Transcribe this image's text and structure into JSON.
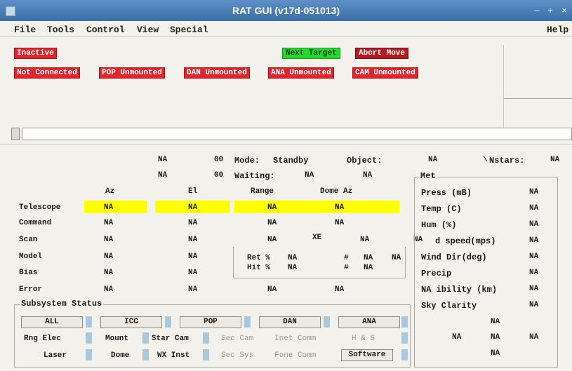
{
  "window": {
    "title": "RAT GUI (v17d-051013)"
  },
  "menu": {
    "file": "File",
    "tools": "Tools",
    "control": "Control",
    "view": "View",
    "special": "Special",
    "help": "Help"
  },
  "status": {
    "inactive": "Inactive",
    "next_target": "Next Target",
    "abort_move": "Abort Move",
    "badges": [
      "Not Connected",
      "POP Unmounted",
      "DAN Unmounted",
      "ANA Unmounted",
      "CAM Unmounted"
    ]
  },
  "info": {
    "row1": {
      "a": "NA",
      "b": "00",
      "mode_label": "Mode:",
      "mode_value": "Standby",
      "object_label": "Object:",
      "object_value": "NA",
      "nstars_label": "Nstars:",
      "nstars_prefix": "\\",
      "nstars_value": "NA"
    },
    "row2": {
      "a": "NA",
      "b": "00",
      "waiting_label": "Waiting:",
      "w1": "NA",
      "w2": "NA"
    }
  },
  "grid": {
    "headers": [
      "Az",
      "El",
      "Range",
      "Dome Az"
    ],
    "rows": [
      {
        "label": "Telescope",
        "vals": [
          "NA",
          "NA",
          "NA",
          "NA"
        ]
      },
      {
        "label": "Command",
        "vals": [
          "NA",
          "NA",
          "NA",
          "NA"
        ]
      },
      {
        "label": "Scan",
        "vals": [
          "NA",
          "NA",
          "NA",
          "NA"
        ]
      },
      {
        "label": "Model",
        "vals": [
          "NA",
          "NA"
        ]
      },
      {
        "label": "Bias",
        "vals": [
          "NA",
          "NA"
        ]
      },
      {
        "label": "Error",
        "vals": [
          "NA",
          "NA",
          "NA",
          "NA"
        ]
      }
    ],
    "xe_label": "XE",
    "scan_extra": "NA",
    "scan_extra2": "NA",
    "ret_label": "Ret %",
    "ret_val": "NA",
    "ret_hash": "#",
    "ret_num": "NA",
    "ret_num2": "NA",
    "hit_label": "Hit %",
    "hit_val": "NA",
    "hit_hash": "#",
    "hit_num": "NA"
  },
  "met": {
    "title": "Met",
    "items": [
      {
        "label": "Press (mB)",
        "value": "NA"
      },
      {
        "label": "Temp (C)",
        "value": "NA"
      },
      {
        "label": "Hum (%)",
        "value": "NA"
      },
      {
        "label": "d speed(mps)",
        "value": "NA"
      },
      {
        "label": "Wind Dir(deg)",
        "value": "NA"
      },
      {
        "label": "Precip",
        "value": "NA"
      },
      {
        "label": "NA ibility (km)",
        "value": "NA"
      },
      {
        "label": "Sky Clarity",
        "value": "NA"
      }
    ],
    "wind_prefix": "NA",
    "bottom": {
      "r1": "NA",
      "r2a": "NA",
      "r2b": "NA",
      "r2c": "NA",
      "r3": "NA"
    }
  },
  "subsystem": {
    "title": "Subsystem Status",
    "buttons": [
      "ALL",
      "ICC",
      "POP",
      "DAN",
      "ANA"
    ],
    "row2": [
      "Rng Elec",
      "Mount",
      "Star Cam",
      "Sec Cam",
      "Inet Comm",
      "H & S"
    ],
    "row3": [
      "Laser",
      "Dome",
      "WX Inst",
      "Sec Sys",
      "Fone Comm",
      "Software"
    ]
  },
  "colors": {
    "titlebar": "#3a6ea6",
    "alert_red": "#e0262c",
    "dark_red": "#b31b20",
    "go_green": "#24d62e",
    "highlight": "#ffff00",
    "indicator": "#aac8dc"
  }
}
